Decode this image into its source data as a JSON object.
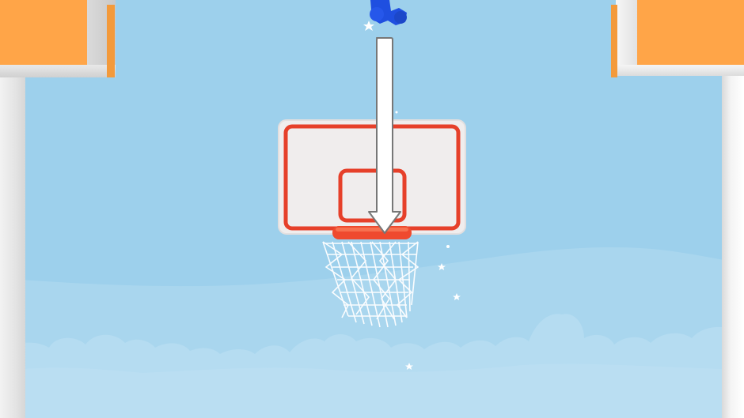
{
  "colors": {
    "sky": "#9dd0ec",
    "hill": "#a9d6ee",
    "cloud": "#b5dcf1",
    "orange_block": "#ffa548",
    "backboard": "#f0eded",
    "backboard_border": "#e6402a",
    "rim": "#ef4a2e",
    "arrow_fill": "#ffffff",
    "arrow_outline": "#7a7a7a",
    "player": "#1f4fe0",
    "net": "#ffffff"
  },
  "icons": {
    "arrow": "down-arrow-icon",
    "sparkle": "star-icon",
    "player": "player-figure-icon"
  }
}
